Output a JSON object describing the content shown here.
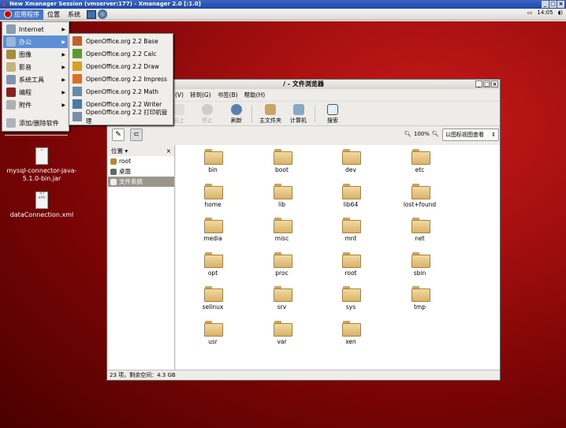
{
  "xmanager": {
    "title": "New Xmanager Session (vmserver:177) - Xmanager 2.0 [:1.0]"
  },
  "panel": {
    "menus": [
      "应用程序",
      "位置",
      "系统"
    ],
    "clock": "14:05"
  },
  "desktop_icons": [
    {
      "label": "mysql-connector-java-5.1.0-bin.jar"
    },
    {
      "label": "dataConnection.xml"
    }
  ],
  "app_menu": {
    "items": [
      {
        "label": "Internet"
      },
      {
        "label": "办公"
      },
      {
        "label": "图像"
      },
      {
        "label": "影音"
      },
      {
        "label": "系统工具"
      },
      {
        "label": "编程"
      },
      {
        "label": "附件"
      }
    ],
    "footer": "添加/删除软件"
  },
  "office_submenu": [
    "OpenOffice.org 2.2 Base",
    "OpenOffice.org 2.2 Calc",
    "OpenOffice.org 2.2 Draw",
    "OpenOffice.org 2.2 Impress",
    "OpenOffice.org 2.2 Math",
    "OpenOffice.org 2.2 Writer",
    "OpenOffice.org 2.2 打印机管理"
  ],
  "window": {
    "title": "/ - 文件浏览器",
    "menubar": [
      "(V)",
      "转到(G)",
      "书签(B)",
      "帮助(H)"
    ],
    "toolbar": {
      "up": "向上",
      "stop": "停止",
      "reload": "刷新",
      "home": "主文件夹",
      "computer": "计算机",
      "search": "搜索"
    },
    "zoom": "100%",
    "view": "以图标视图查看",
    "sidebar": {
      "title": "位置",
      "items": [
        "root",
        "桌面",
        "文件系统"
      ]
    },
    "files": [
      "bin",
      "boot",
      "dev",
      "etc",
      "home",
      "lib",
      "lib64",
      "lost+found",
      "media",
      "misc",
      "mnt",
      "net",
      "opt",
      "proc",
      "root",
      "sbin",
      "selinux",
      "srv",
      "sys",
      "tmp",
      "usr",
      "var",
      "xen"
    ],
    "status": "23 项，剩余空间：4.3 GB"
  }
}
